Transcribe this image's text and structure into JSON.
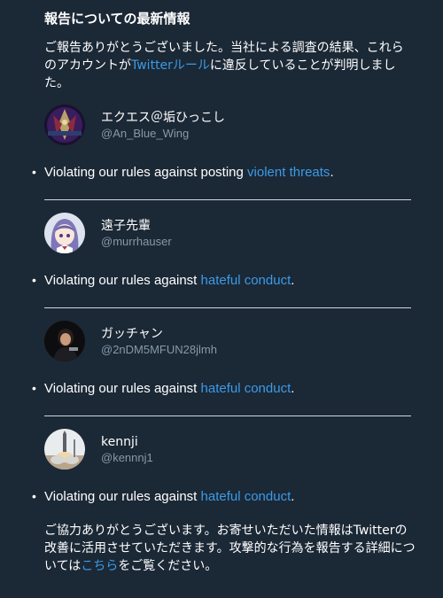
{
  "title": "報告についての最新情報",
  "intro": {
    "before": "ご報告ありがとうございました。当社による調査の結果、これらのアカウントが",
    "link": "Twitterルール",
    "after": "に違反していることが判明しました。"
  },
  "violation_prefix": "Violating our rules against",
  "accounts": [
    {
      "display_name": "エクエス＠垢ひっこし",
      "handle": "@An_Blue_Wing",
      "violation_prefix": "Violating our rules against posting",
      "violation_link": "violent threats",
      "violation_suffix": "."
    },
    {
      "display_name": "遠子先輩",
      "handle": "@murrhauser",
      "violation_prefix": "Violating our rules against",
      "violation_link": "hateful conduct",
      "violation_suffix": "."
    },
    {
      "display_name": "ガッチャン",
      "handle": "@2nDM5MFUN28jlmh",
      "violation_prefix": "Violating our rules against",
      "violation_link": "hateful conduct",
      "violation_suffix": "."
    },
    {
      "display_name": "kennji",
      "handle": "@kennnj1",
      "violation_prefix": "Violating our rules against",
      "violation_link": "hateful conduct",
      "violation_suffix": "."
    }
  ],
  "footer": {
    "before": "ご協力ありがとうございます。お寄せいただいた情報はTwitterの改善に活用させていただきます。攻撃的な行為を報告する詳細については",
    "link": "こちら",
    "after": "をご覧ください。"
  },
  "colors": {
    "background": "#1b2836",
    "link": "#3b9be6",
    "handle": "#8899a6"
  }
}
